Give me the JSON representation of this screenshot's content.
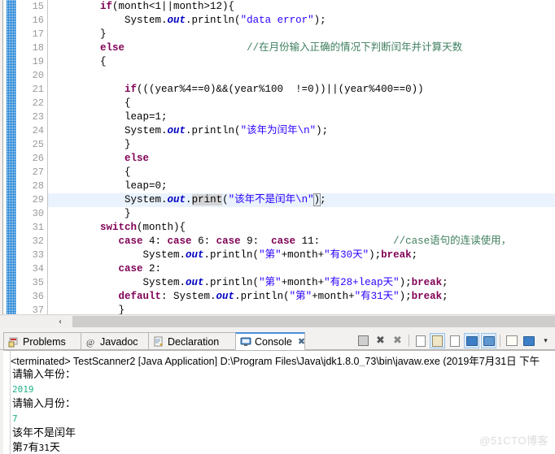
{
  "editor": {
    "first_line": 15,
    "highlight_line": 29,
    "lines": [
      {
        "n": 15,
        "text": "        if(month<1||month>12){"
      },
      {
        "n": 16,
        "text": "            System.out.println(\"data error\");"
      },
      {
        "n": 17,
        "text": "        }"
      },
      {
        "n": 18,
        "text": "        else                    //在月份输入正确的情况下判断闰年并计算天数"
      },
      {
        "n": 19,
        "text": "        {"
      },
      {
        "n": 20,
        "text": ""
      },
      {
        "n": 21,
        "text": "            if(((year%4==0)&&(year%100  !=0))||(year%400==0))"
      },
      {
        "n": 22,
        "text": "            {"
      },
      {
        "n": 23,
        "text": "            leap=1;"
      },
      {
        "n": 24,
        "text": "            System.out.println(\"该年为闰年\\n\");"
      },
      {
        "n": 25,
        "text": "            }"
      },
      {
        "n": 26,
        "text": "            else"
      },
      {
        "n": 27,
        "text": "            {"
      },
      {
        "n": 28,
        "text": "            leap=0;"
      },
      {
        "n": 29,
        "text": "            System.out.print(\"该年不是闰年\\n\");"
      },
      {
        "n": 30,
        "text": "            }"
      },
      {
        "n": 31,
        "text": "        switch(month){"
      },
      {
        "n": 32,
        "text": "           case 4: case 6: case 9:  case 11:            //case语句的连读使用，"
      },
      {
        "n": 33,
        "text": "               System.out.println(\"第\"+month+\"有30天\");break;"
      },
      {
        "n": 34,
        "text": "           case 2:"
      },
      {
        "n": 35,
        "text": "               System.out.println(\"第\"+month+\"有28+leap天\");break;"
      },
      {
        "n": 36,
        "text": "           default: System.out.println(\"第\"+month+\"有31天\");break;"
      },
      {
        "n": 37,
        "text": "           }"
      }
    ],
    "scrollbar": {
      "left_arrow": "‹"
    }
  },
  "panel": {
    "tabs": [
      {
        "label": "Problems",
        "icon": "problems-icon",
        "active": false,
        "closeable": false
      },
      {
        "label": "Javadoc",
        "icon": "javadoc-at-icon",
        "active": false,
        "closeable": false
      },
      {
        "label": "Declaration",
        "icon": "declaration-icon",
        "active": false,
        "closeable": false
      },
      {
        "label": "Console",
        "icon": "console-monitor-icon",
        "active": true,
        "closeable": true,
        "close_glyph": "✖"
      }
    ],
    "toolbar": [
      {
        "name": "terminate-button",
        "glyph": "■",
        "selected": false
      },
      {
        "name": "remove-launch-button",
        "glyph": "✖",
        "selected": false
      },
      {
        "name": "remove-all-terminated-button",
        "glyph": "✖",
        "selected": false
      },
      {
        "name": "clear-console-button",
        "glyph": "doc",
        "selected": false
      },
      {
        "name": "scroll-lock-button",
        "glyph": "lock",
        "selected": true
      },
      {
        "name": "word-wrap-button",
        "glyph": "wrap",
        "selected": false
      },
      {
        "name": "show-console-on-output-button",
        "glyph": "mon",
        "selected": true
      },
      {
        "name": "show-console-on-error-button",
        "glyph": "mon-err",
        "selected": true
      },
      {
        "name": "pin-console-button",
        "glyph": "pin",
        "selected": false
      },
      {
        "name": "display-selected-console-button",
        "glyph": "monitor",
        "selected": false
      },
      {
        "name": "open-console-menu-button",
        "glyph": "▾",
        "selected": false
      }
    ],
    "console": {
      "terminated_line": "<terminated> TestScanner2 [Java Application] D:\\Program Files\\Java\\jdk1.8.0_73\\bin\\javaw.exe (2019年7月31日 下午",
      "output": [
        {
          "text": "请输入年份：",
          "kind": "stdout"
        },
        {
          "text": "2019",
          "kind": "stdin"
        },
        {
          "text": "请输入月份：",
          "kind": "stdout"
        },
        {
          "text": "7",
          "kind": "stdin"
        },
        {
          "text": "该年不是闰年",
          "kind": "stdout"
        },
        {
          "text": "第7有31天",
          "kind": "stdout"
        }
      ]
    }
  },
  "watermark": {
    "text": "@51CTO博客"
  },
  "colors": {
    "keyword": "#7f0055",
    "string": "#2a00ff",
    "comment": "#3f7f5f",
    "field": "#0000c0",
    "line_highlight": "#e9f2fd",
    "stdin": "#20b08a",
    "ruler_blue": "#1a7fd4",
    "tab_active_top": "#4a90d9"
  }
}
